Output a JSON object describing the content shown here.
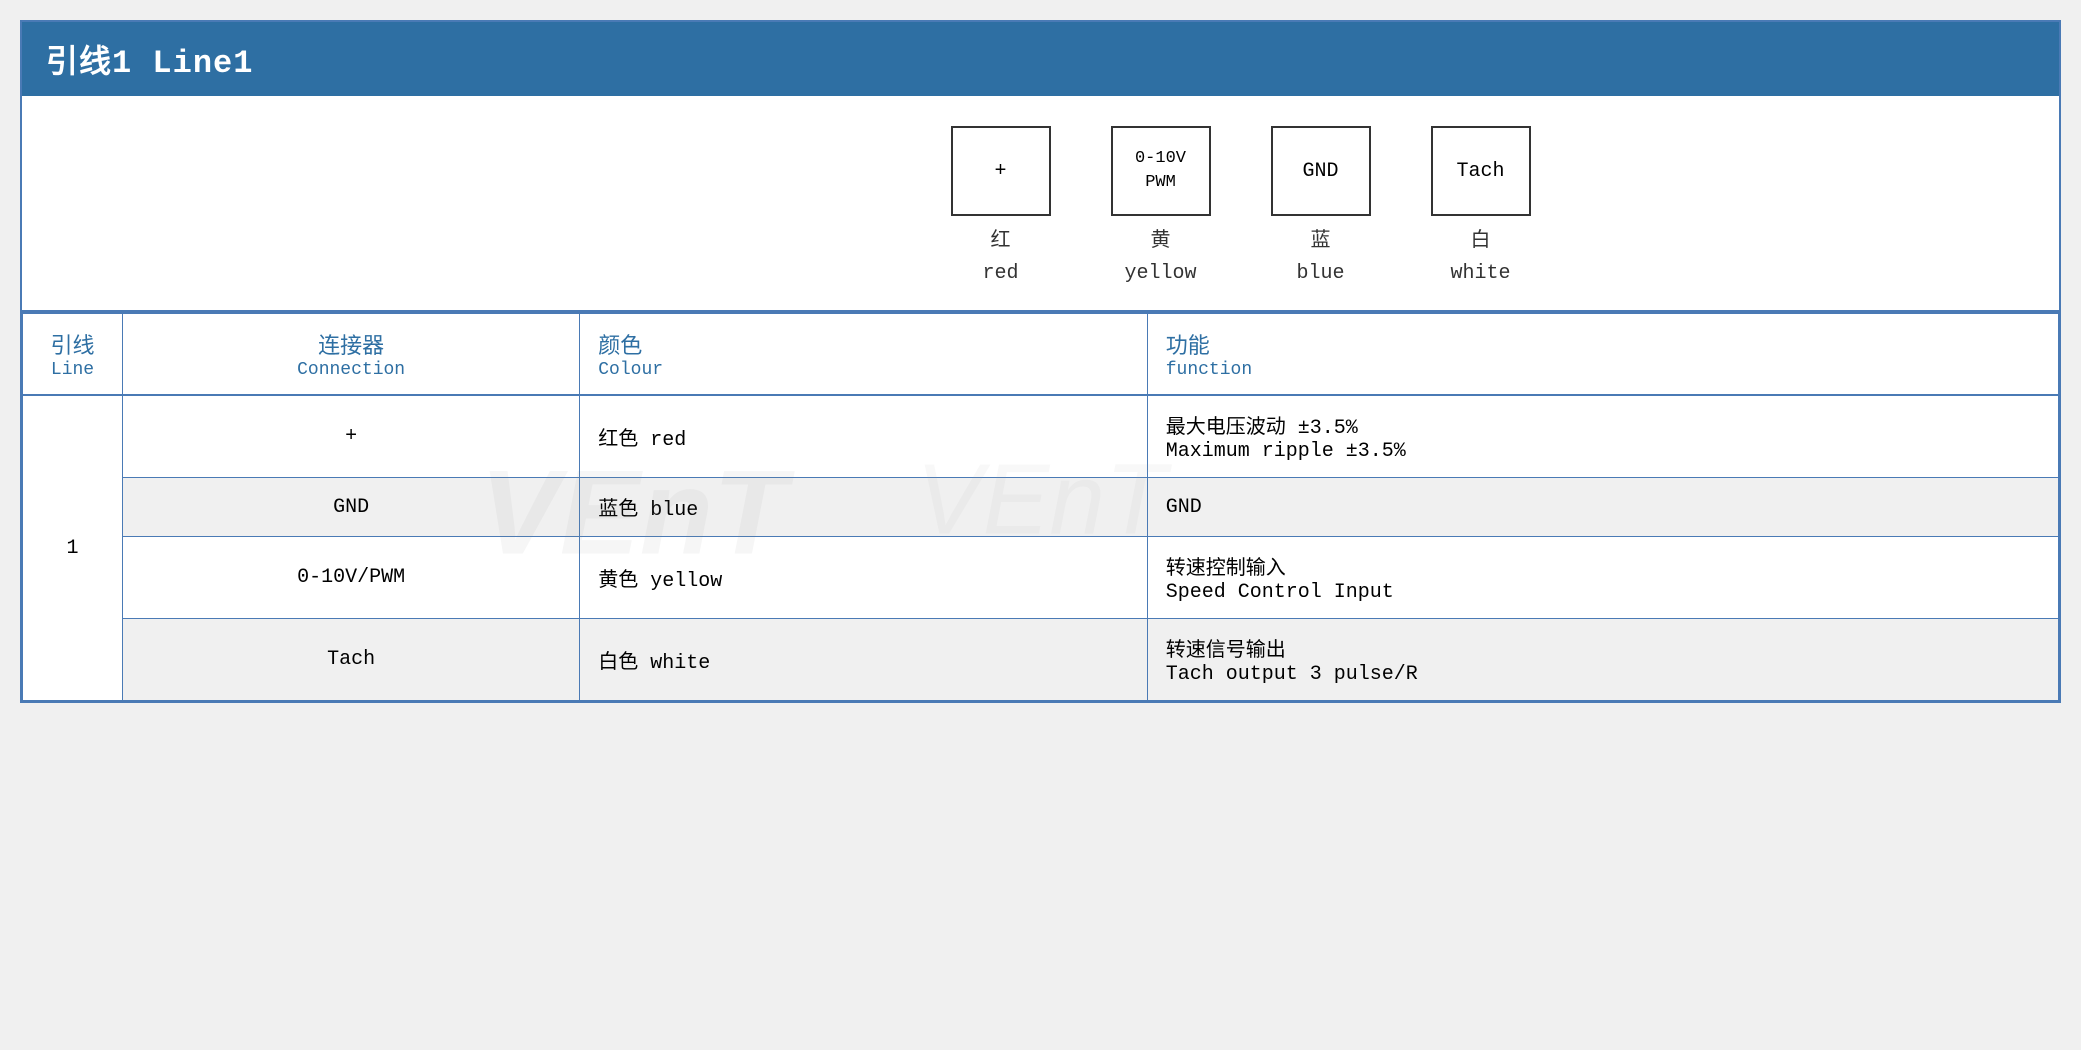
{
  "title": "引线1 Line1",
  "connectors": [
    {
      "id": "plus",
      "label": "+",
      "chinese": "红",
      "english": "red"
    },
    {
      "id": "pwm",
      "label": "0-10V\nPWM",
      "chinese": "黄",
      "english": "yellow"
    },
    {
      "id": "gnd",
      "label": "GND",
      "chinese": "蓝",
      "english": "blue"
    },
    {
      "id": "tach",
      "label": "Tach",
      "chinese": "白",
      "english": "white"
    }
  ],
  "table": {
    "headers": {
      "line_chinese": "引线",
      "line_english": "Line",
      "connection_chinese": "连接器",
      "connection_english": "Connection",
      "colour_chinese": "颜色",
      "colour_english": "Colour",
      "function_chinese": "功能",
      "function_english": "function"
    },
    "rows": [
      {
        "line": "1",
        "connection": "+",
        "colour": "红色 red",
        "function_chinese": "最大电压波动 ±3.5%",
        "function_english": "Maximum ripple ±3.5%"
      },
      {
        "line": "",
        "connection": "GND",
        "colour": "蓝色 blue",
        "function_chinese": "GND",
        "function_english": ""
      },
      {
        "line": "",
        "connection": "0-10V/PWM",
        "colour": "黄色 yellow",
        "function_chinese": "转速控制输入",
        "function_english": "Speed Control Input"
      },
      {
        "line": "",
        "connection": "Tach",
        "colour": "白色 white",
        "function_chinese": "转速信号输出",
        "function_english": "Tach output 3 pulse/R"
      }
    ]
  },
  "watermark_text": "VEnT"
}
